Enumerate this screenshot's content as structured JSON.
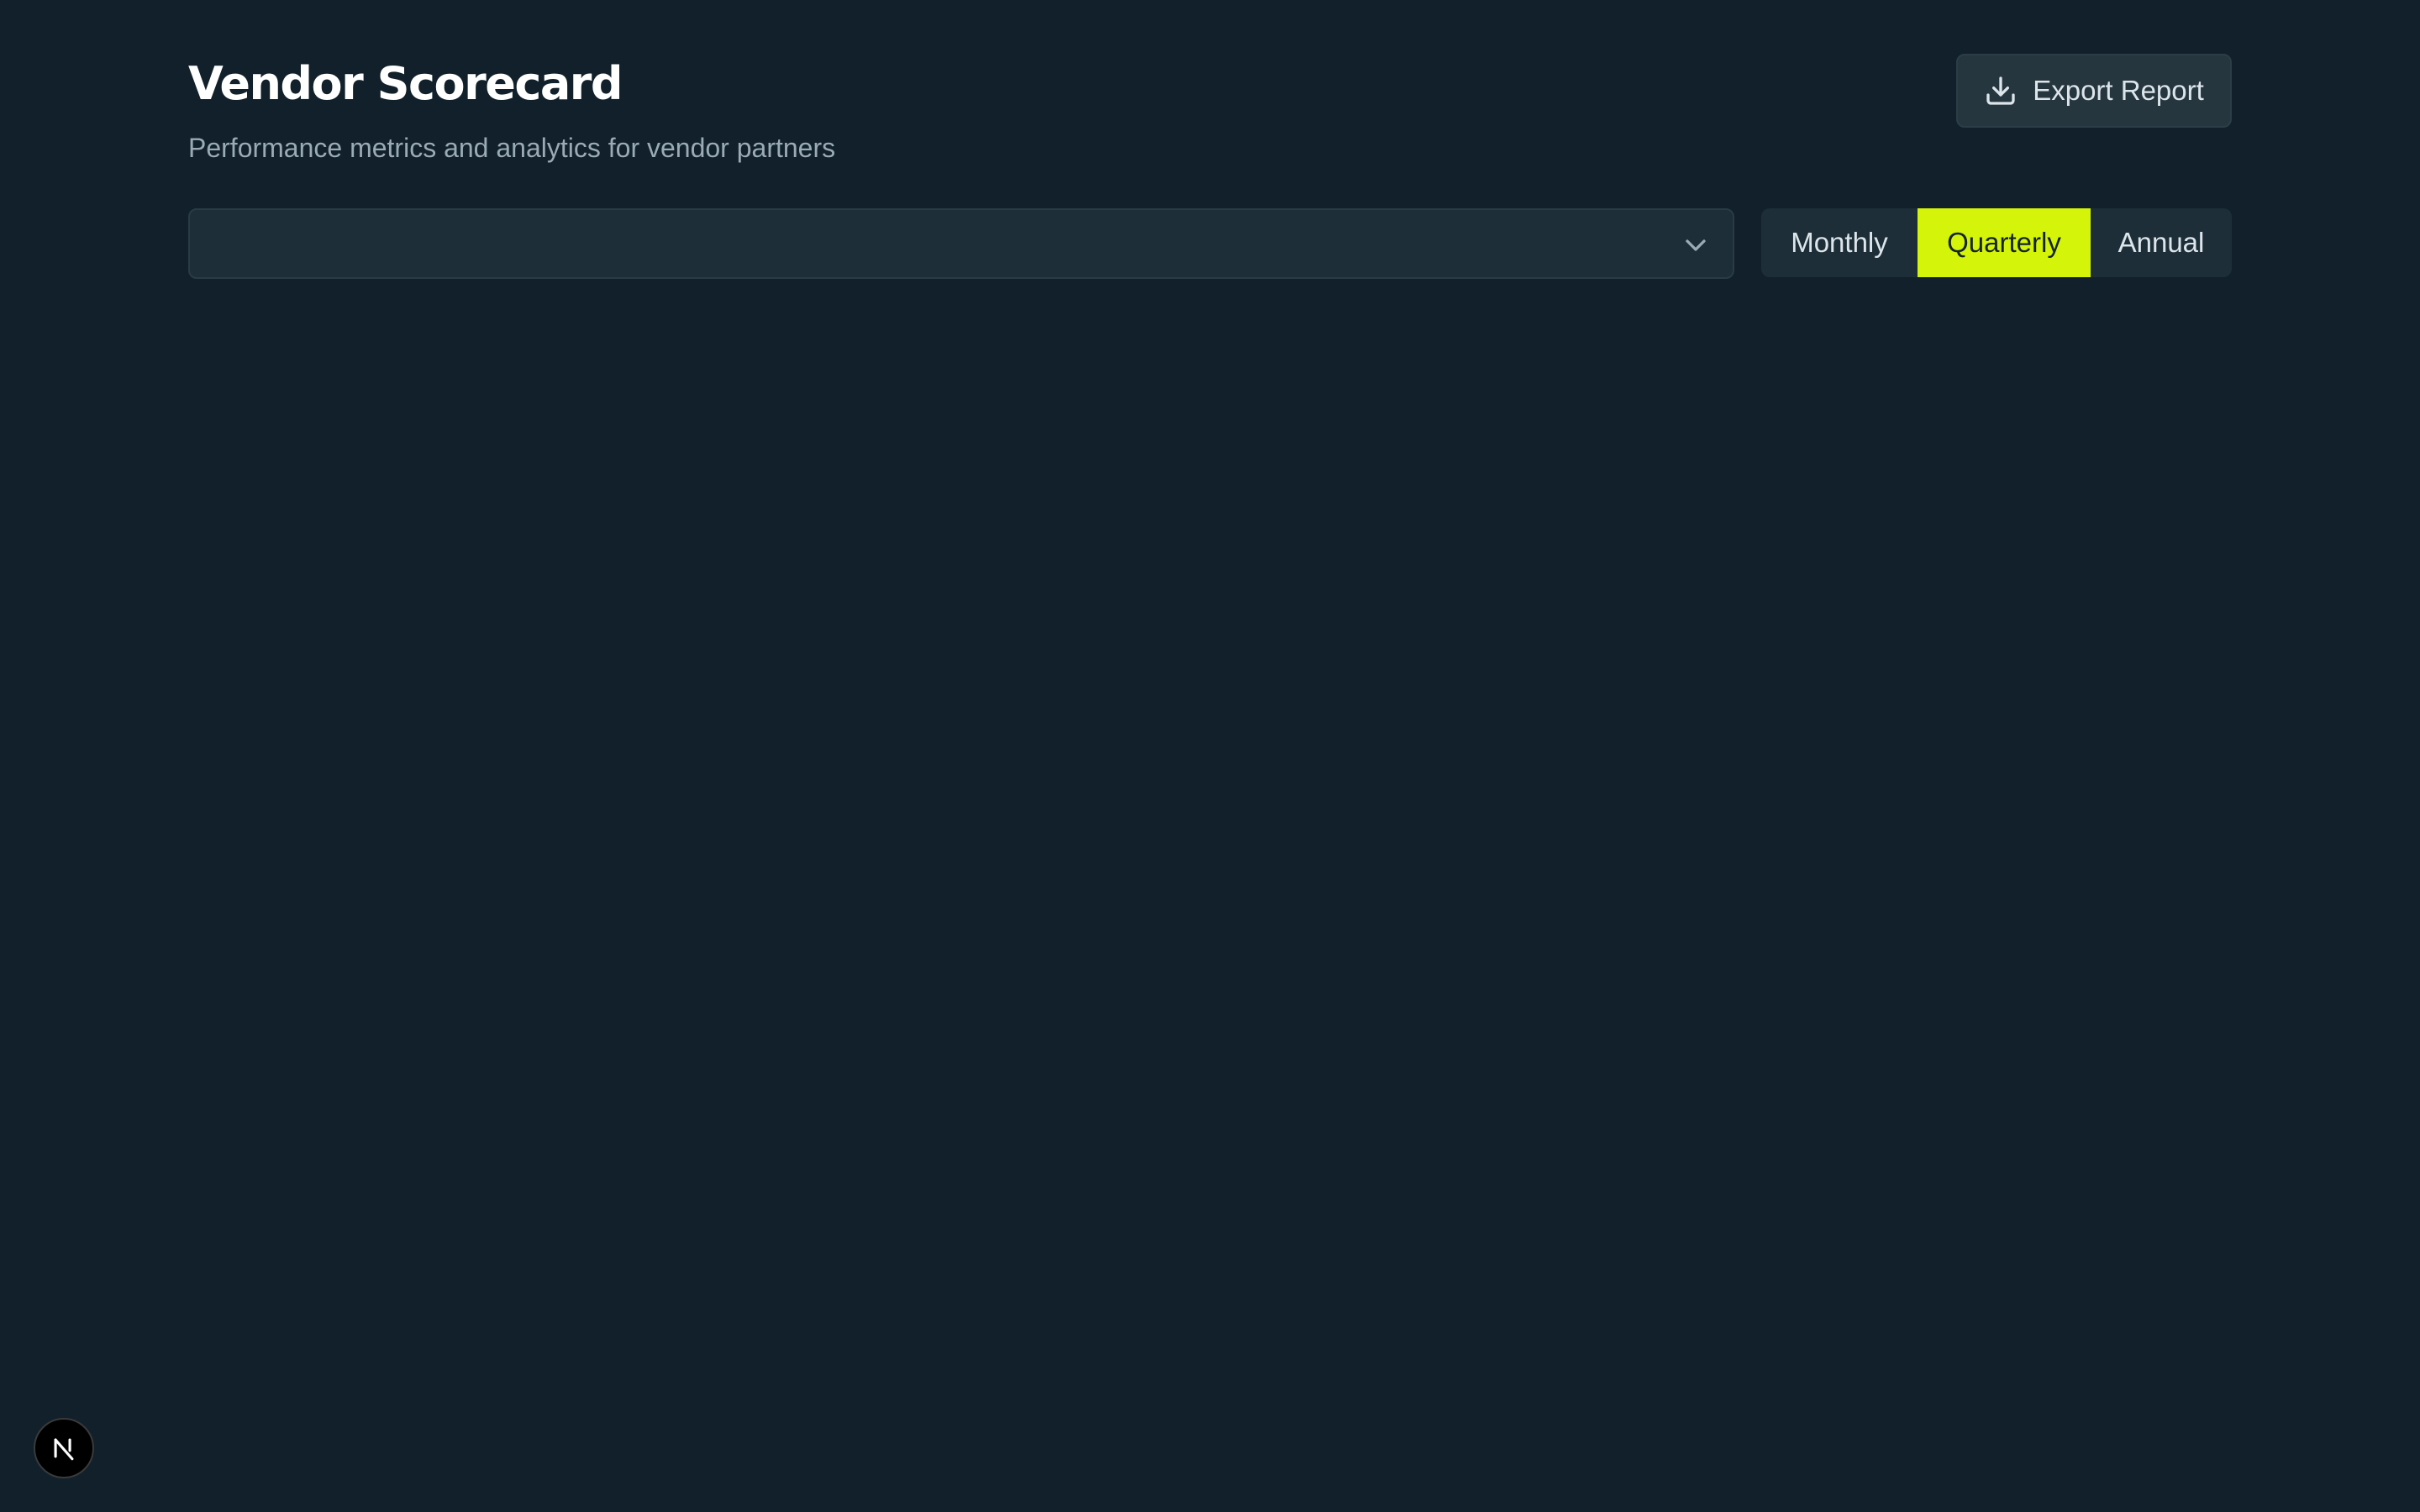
{
  "header": {
    "title": "Vendor Scorecard",
    "subtitle": "Performance metrics and analytics for vendor partners",
    "export_label": "Export Report"
  },
  "controls": {
    "vendor_select": {
      "value": "",
      "icon": "chevron-down-icon"
    },
    "period_options": [
      {
        "label": "Monthly",
        "selected": false
      },
      {
        "label": "Quarterly",
        "selected": true
      },
      {
        "label": "Annual",
        "selected": false
      }
    ]
  },
  "colors": {
    "background": "#11202a",
    "surface": "#1d2e38",
    "button": "#26363f",
    "accent": "#d4f40a",
    "muted_text": "#9aabb5"
  },
  "icons": {
    "export": "download-icon",
    "dev_badge": "next-logo-icon"
  }
}
